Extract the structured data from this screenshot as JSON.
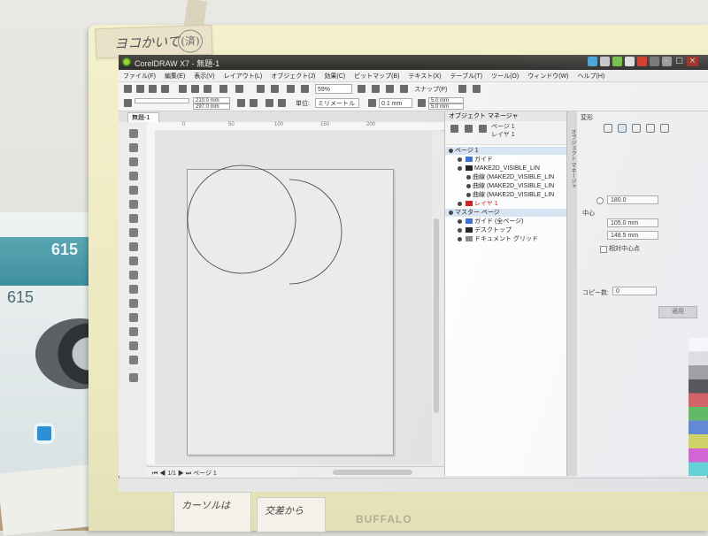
{
  "environment": {
    "tape_note": "ヨコかいて",
    "tape_stamp": "(済)",
    "box_number_top": "615",
    "box_number_side": "615",
    "monitor_brand": "BUFFALO",
    "sticky_note_left": "カーソルは",
    "sticky_note_right": "交差から"
  },
  "window": {
    "title": "CorelDRAW X7 - 無題-1"
  },
  "menubar": {
    "items": [
      "ファイル(F)",
      "編集(E)",
      "表示(V)",
      "レイアウト(L)",
      "オブジェクト(J)",
      "効果(C)",
      "ビットマップ(B)",
      "テキスト(X)",
      "テーブル(T)",
      "ツール(O)",
      "ウィンドウ(W)",
      "ヘルプ(H)"
    ]
  },
  "toolbar": {
    "zoom": "59%",
    "snap_label": "スナップ(P)",
    "width": "210.0 mm",
    "height": "297.0 mm",
    "unit_label": "単位:",
    "unit_value": "ミリメートル",
    "nudge": "0.1 mm",
    "dup_x": "5.0 mm",
    "dup_y": "5.0 mm"
  },
  "document": {
    "tab": "無題-1",
    "page_nav": "1/1",
    "page_label": "ページ 1",
    "ruler_marks": [
      "0",
      "50",
      "100",
      "150",
      "200"
    ]
  },
  "object_manager": {
    "title": "オブジェクト マネージャ",
    "current_page": "ページ 1",
    "current_layer": "レイヤ 1",
    "rows": [
      {
        "text": "ページ 1",
        "indent": 0,
        "selected": true,
        "swatch": ""
      },
      {
        "text": "ガイド",
        "indent": 1,
        "selected": false,
        "swatch": "#3a6fd8"
      },
      {
        "text": "MAKE2D_VISIBLE_LIN",
        "indent": 1,
        "selected": false,
        "swatch": "#222222"
      },
      {
        "text": "曲線 (MAKE2D_VISIBLE_LIN",
        "indent": 2,
        "selected": false,
        "swatch": ""
      },
      {
        "text": "曲線 (MAKE2D_VISIBLE_LIN",
        "indent": 2,
        "selected": false,
        "swatch": ""
      },
      {
        "text": "曲線 (MAKE2D_VISIBLE_LIN",
        "indent": 2,
        "selected": false,
        "swatch": ""
      },
      {
        "text": "レイヤ 1",
        "indent": 1,
        "selected": false,
        "swatch": "#d02020"
      },
      {
        "text": "マスター ページ",
        "indent": 0,
        "selected": true,
        "swatch": ""
      },
      {
        "text": "ガイド (全ページ)",
        "indent": 1,
        "selected": false,
        "swatch": "#3a6fd8"
      },
      {
        "text": "デスクトップ",
        "indent": 1,
        "selected": false,
        "swatch": "#222222"
      },
      {
        "text": "ドキュメント グリッド",
        "indent": 1,
        "selected": false,
        "swatch": "#888888"
      }
    ]
  },
  "transform": {
    "title": "変形",
    "angle": "180.0",
    "center_label": "中心",
    "center_x": "105.0 mm",
    "center_y": "148.5 mm",
    "relative_center": "相対中心点",
    "copies_label": "コピー数:",
    "copies_value": "0",
    "apply": "適用"
  },
  "dock_tab": "オブジェクト マネージャ"
}
